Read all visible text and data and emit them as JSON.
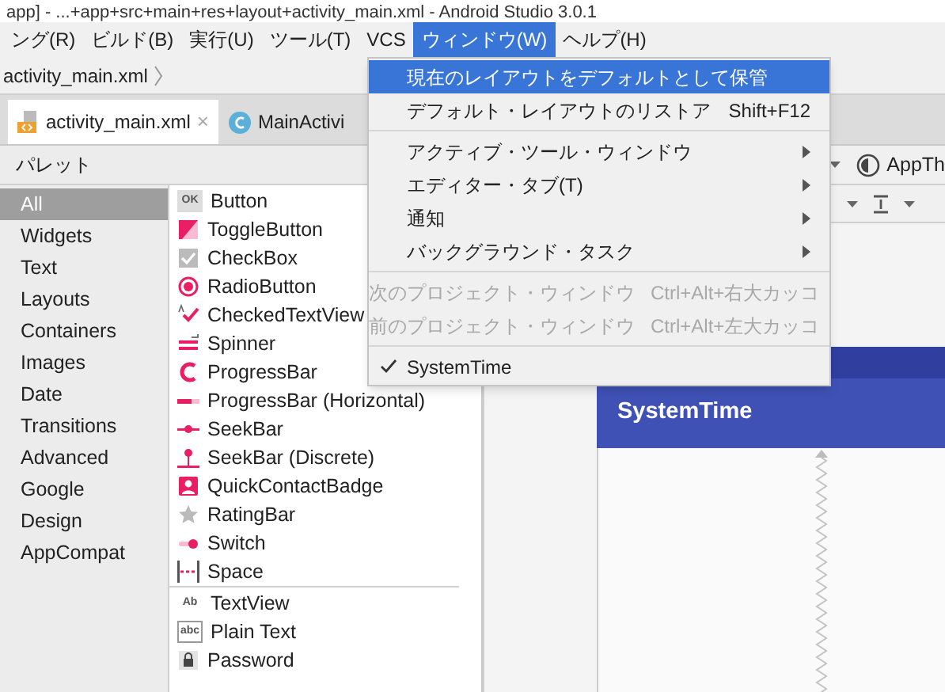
{
  "window": {
    "title": "app] - ...+app+src+main+res+layout+activity_main.xml - Android Studio 3.0.1"
  },
  "menu_bar": [
    {
      "label": "ング(R)",
      "selected": false
    },
    {
      "label": "ビルド(B)",
      "selected": false
    },
    {
      "label": "実行(U)",
      "selected": false
    },
    {
      "label": "ツール(T)",
      "selected": false
    },
    {
      "label": "VCS",
      "selected": false
    },
    {
      "label": "ウィンドウ(W)",
      "selected": true
    },
    {
      "label": "ヘルプ(H)",
      "selected": false
    }
  ],
  "breadcrumb": "activity_main.xml",
  "editor_tabs": [
    {
      "label": "activity_main.xml",
      "selected": true,
      "kind": "xml",
      "close": "×"
    },
    {
      "label": "MainActivi",
      "selected": false,
      "kind": "class"
    }
  ],
  "palette": {
    "title": "パレット",
    "categories": [
      {
        "label": "All",
        "selected": true
      },
      {
        "label": "Widgets",
        "selected": false
      },
      {
        "label": "Text",
        "selected": false
      },
      {
        "label": "Layouts",
        "selected": false
      },
      {
        "label": "Containers",
        "selected": false
      },
      {
        "label": "Images",
        "selected": false
      },
      {
        "label": "Date",
        "selected": false
      },
      {
        "label": "Transitions",
        "selected": false
      },
      {
        "label": "Advanced",
        "selected": false
      },
      {
        "label": "Google",
        "selected": false
      },
      {
        "label": "Design",
        "selected": false
      },
      {
        "label": "AppCompat",
        "selected": false
      }
    ],
    "groups": [
      [
        {
          "label": "Button",
          "kind": "button",
          "icon_text": "OK"
        },
        {
          "label": "ToggleButton",
          "kind": "toggle"
        },
        {
          "label": "CheckBox",
          "kind": "checkbox"
        },
        {
          "label": "RadioButton",
          "kind": "radio"
        },
        {
          "label": "CheckedTextView",
          "kind": "checkedtext"
        },
        {
          "label": "Spinner",
          "kind": "spinner"
        },
        {
          "label": "ProgressBar",
          "kind": "progress"
        },
        {
          "label": "ProgressBar (Horizontal)",
          "kind": "hprogress"
        },
        {
          "label": "SeekBar",
          "kind": "seek"
        },
        {
          "label": "SeekBar (Discrete)",
          "kind": "discrete"
        },
        {
          "label": "QuickContactBadge",
          "kind": "contact"
        },
        {
          "label": "RatingBar",
          "kind": "star"
        },
        {
          "label": "Switch",
          "kind": "switch"
        },
        {
          "label": "Space",
          "kind": "space"
        }
      ],
      [
        {
          "label": "TextView",
          "kind": "textview",
          "icon_text": "Ab"
        },
        {
          "label": "Plain Text",
          "kind": "plaintext",
          "icon_text": "abc"
        },
        {
          "label": "Password",
          "kind": "password"
        }
      ]
    ]
  },
  "design_toolbar": {
    "theme": "AppTh"
  },
  "preview": {
    "app_title": "SystemTime"
  },
  "dropdown": [
    [
      {
        "label": "現在のレイアウトをデフォルトとして保管",
        "selected": true,
        "disabled": false,
        "submenu": false,
        "checked": false
      },
      {
        "label": "デフォルト・レイアウトのリストア",
        "shortcut": "Shift+F12",
        "selected": false,
        "disabled": false,
        "submenu": false,
        "checked": false
      }
    ],
    [
      {
        "label": "アクティブ・ツール・ウィンドウ",
        "selected": false,
        "disabled": false,
        "submenu": true,
        "checked": false
      },
      {
        "label": "エディター・タブ(T)",
        "selected": false,
        "disabled": false,
        "submenu": true,
        "checked": false
      },
      {
        "label": "通知",
        "selected": false,
        "disabled": false,
        "submenu": true,
        "checked": false
      },
      {
        "label": "バックグラウンド・タスク",
        "selected": false,
        "disabled": false,
        "submenu": true,
        "checked": false
      }
    ],
    [
      {
        "label": "次のプロジェクト・ウィンドウ",
        "shortcut": "Ctrl+Alt+右大カッコ",
        "selected": false,
        "disabled": true,
        "checked": false
      },
      {
        "label": "前のプロジェクト・ウィンドウ",
        "shortcut": "Ctrl+Alt+左大カッコ",
        "selected": false,
        "disabled": true,
        "checked": false
      }
    ],
    [
      {
        "label": "SystemTime",
        "selected": false,
        "disabled": false,
        "submenu": false,
        "checked": true
      }
    ]
  ]
}
